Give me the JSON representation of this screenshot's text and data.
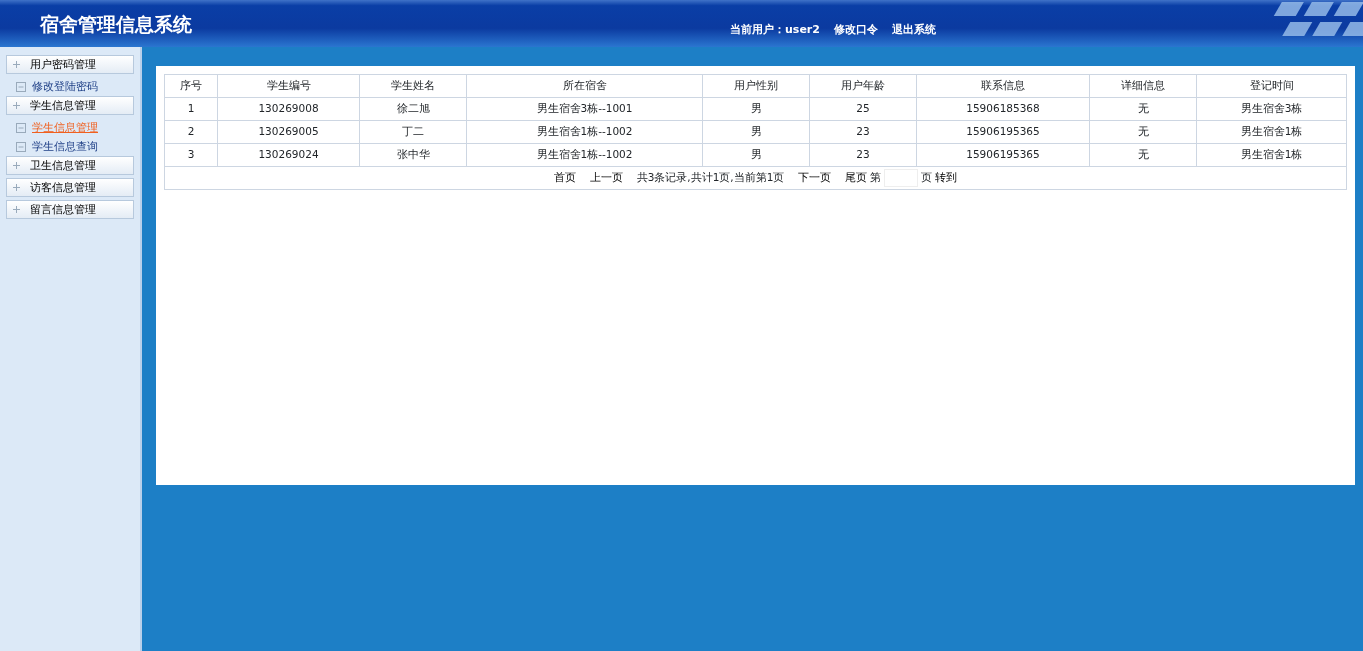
{
  "header": {
    "title": "宿舍管理信息系统",
    "current_user": "当前用户：user2",
    "links": [
      "修改口令",
      "退出系统"
    ]
  },
  "sidebar": {
    "groups": [
      {
        "label": "用户密码管理",
        "children": [
          {
            "label": "修改登陆密码",
            "selected": false
          }
        ]
      },
      {
        "label": "学生信息管理",
        "children": [
          {
            "label": "学生信息管理",
            "selected": true
          },
          {
            "label": "学生信息查询",
            "selected": false
          }
        ]
      },
      {
        "label": "卫生信息管理"
      },
      {
        "label": "访客信息管理"
      },
      {
        "label": "留言信息管理"
      }
    ]
  },
  "table": {
    "columns": [
      "序号",
      "学生编号",
      "学生姓名",
      "所在宿舍",
      "用户性别",
      "用户年龄",
      "联系信息",
      "详细信息",
      "登记时间"
    ],
    "rows": [
      [
        "1",
        "130269008",
        "徐二旭",
        "男生宿舍3栋--1001",
        "男",
        "25",
        "15906185368",
        "无",
        "男生宿舍3栋"
      ],
      [
        "2",
        "130269005",
        "丁二",
        "男生宿舍1栋--1002",
        "男",
        "23",
        "15906195365",
        "无",
        "男生宿舍1栋"
      ],
      [
        "3",
        "130269024",
        "张中华",
        "男生宿舍1栋--1002",
        "男",
        "23",
        "15906195365",
        "无",
        "男生宿舍1栋"
      ]
    ]
  },
  "pagination": {
    "first": "首页",
    "prev": "上一页",
    "summary": "共3条记录,共计1页,当前第1页",
    "next": "下一页",
    "last": "尾页",
    "page_label_before": "第",
    "page_label_after": "页",
    "go": "转到"
  }
}
